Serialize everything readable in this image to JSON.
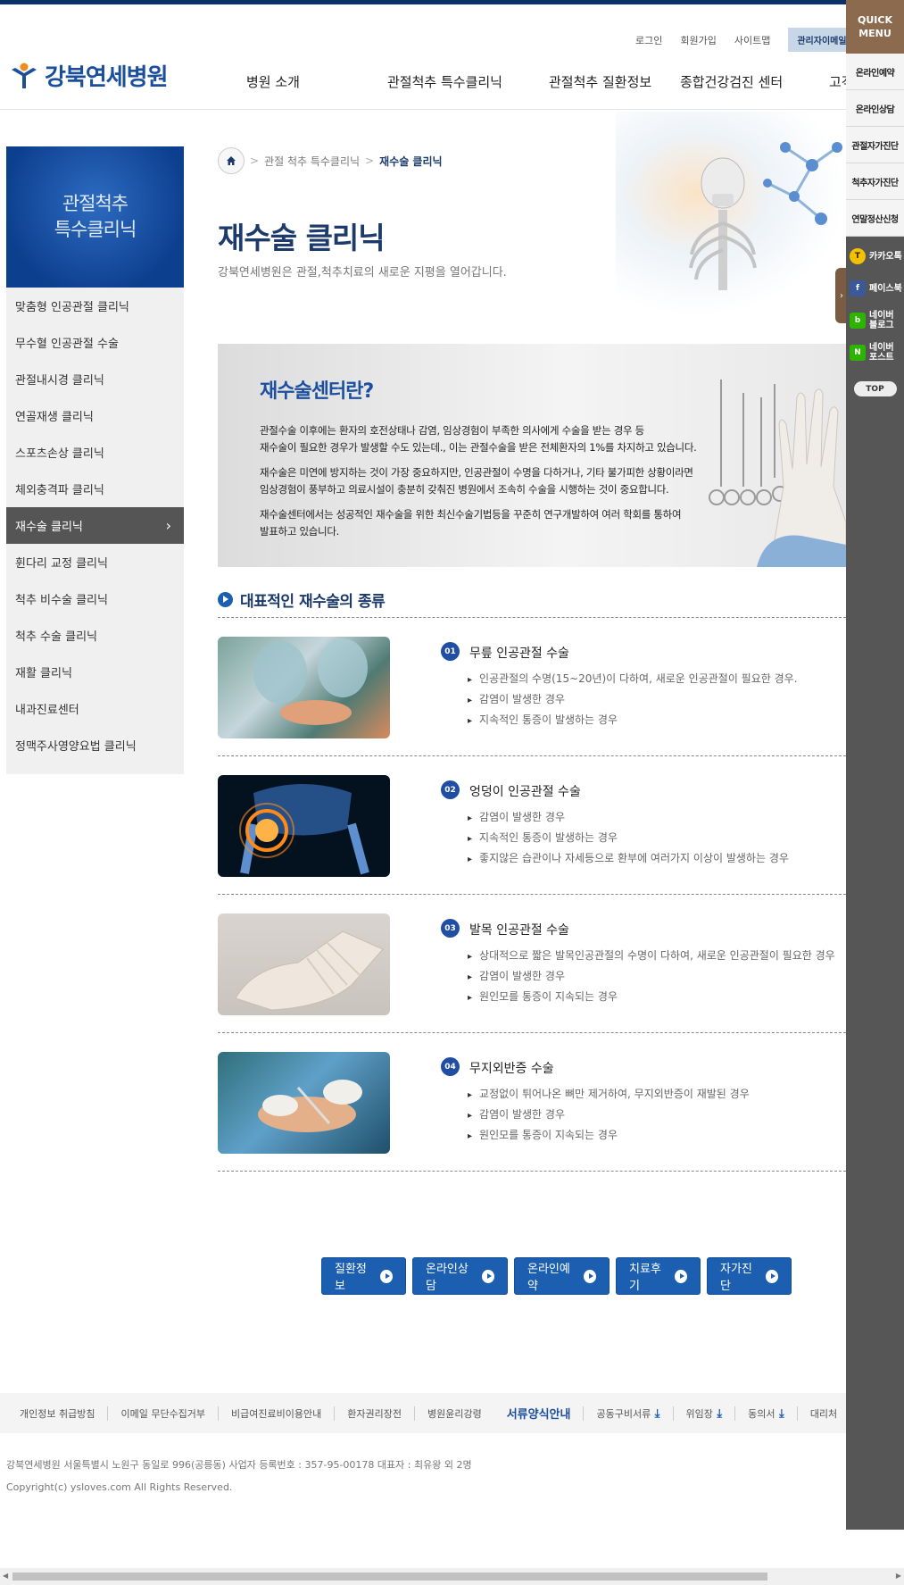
{
  "util": {
    "login": "로그인",
    "join": "회원가입",
    "sitemap": "사이트맵",
    "admin": "관리자이메일"
  },
  "logo": {
    "text": "강북연세병원"
  },
  "gnb": [
    "병원 소개",
    "관절척추 특수클리닉",
    "관절척추 질환정보",
    "종합건강검진 센터",
    "고객"
  ],
  "lnb": {
    "title": "관절척추\n특수클리닉",
    "items": [
      "맞춤형 인공관절 클리닉",
      "무수혈 인공관절 수술",
      "관절내시경 클리닉",
      "연골재생 클리닉",
      "스포츠손상 클리닉",
      "체외충격파 클리닉",
      "재수술 클리닉",
      "휜다리 교정 클리닉",
      "척추 비수술 클리닉",
      "척추 수술 클리닉",
      "재활 클리닉",
      "내과진료센터",
      "정맥주사영양요법 클리닉"
    ],
    "active_index": 6
  },
  "breadcrumb": {
    "parent": "관절 척추 특수클리닉",
    "current": "재수술 클리닉"
  },
  "page": {
    "title": "재수술 클리닉",
    "subtitle": "강북연세병원은 관절,척추치료의 새로운 지평을 열어갑니다."
  },
  "info": {
    "title": "재수술센터란?",
    "p1": "관절수술 이후에는 환자의 호전상태나 감염, 임상경험이 부족한 의사에게 수술을 받는 경우 등\n재수술이 필요한 경우가 발생할 수도 있는데., 이는 관절수술을 받은 전체환자의 1%를 차지하고 있습니다.",
    "p2": "재수술은 미연에 방지하는 것이 가장 중요하지만, 인공관절이 수명을 다하거나, 기타 불가피한 상황이라면\n임상경험이 풍부하고 의료시설이 충분히 갖춰진 병원에서 조속히 수술을 시행하는 것이 중요합니다.",
    "p3": "재수술센터에서는 성공적인 재수술을 위한 최신수술기법등을 꾸준히 연구개발하여 여러 학회를 통하여\n발표하고 있습니다."
  },
  "section": {
    "title": "대표적인 재수술의 종류"
  },
  "surgeries": [
    {
      "num": "01",
      "title": "무릎 인공관절 수술",
      "points": [
        "인공관절의 수명(15~20년)이 다하여, 새로운 인공관절이 필요한 경우.",
        "감염이 발생한 경우",
        "지속적인 통증이 발생하는 경우"
      ]
    },
    {
      "num": "02",
      "title": "엉덩이 인공관절 수술",
      "points": [
        "감염이 발생한 경우",
        "지속적인 통증이 발생하는 경우",
        "좋지않은 습관이나 자세등으로 환부에 여러가지 이상이 발생하는 경우"
      ]
    },
    {
      "num": "03",
      "title": "발목 인공관절 수술",
      "points": [
        "상대적으로 짧은 발목인공관절의 수명이 다하여, 새로운 인공관절이 필요한 경우",
        "감염이 발생한 경우",
        "원인모를 통증이 지속되는 경우"
      ]
    },
    {
      "num": "04",
      "title": "무지외반증 수술",
      "points": [
        "교정없이 튀어나온 뼈만 제거하여, 무지외반증이 재발된 경우",
        "감염이 발생한 경우",
        "원인모를 통증이 지속되는 경우"
      ]
    }
  ],
  "buttons": [
    "질환정보",
    "온라인상담",
    "온라인예약",
    "치료후기",
    "자가진단"
  ],
  "footer": {
    "links": [
      "개인정보 취급방침",
      "이메일 무단수집거부",
      "비급여진료비이용안내",
      "환자권리장전",
      "병원윤리강령"
    ],
    "forms_title": "서류양식안내",
    "downloads": [
      "공동구비서류",
      "위임장",
      "동의서",
      "대리처"
    ],
    "address": "강북연세병원 서울특별시 노원구 동일로 996(공릉동) 사업자 등록번호 : 357-95-00178 대표자 : 최유왕 외 2명",
    "copyright": "Copyright(c) ysloves.com All Rights Reserved."
  },
  "quick": {
    "title": "QUICK\nMENU",
    "items": [
      "온라인예약",
      "온라인상담",
      "관절자가진단",
      "척추자가진단",
      "연말정산신청"
    ],
    "social": [
      {
        "label": "카카오톡",
        "color": "#f2c200"
      },
      {
        "label": "페이스북",
        "color": "#3b5998"
      },
      {
        "label": "네이버\n블로그",
        "color": "#2db400"
      },
      {
        "label": "네이버\n포스트",
        "color": "#2db400"
      }
    ],
    "top": "TOP"
  }
}
